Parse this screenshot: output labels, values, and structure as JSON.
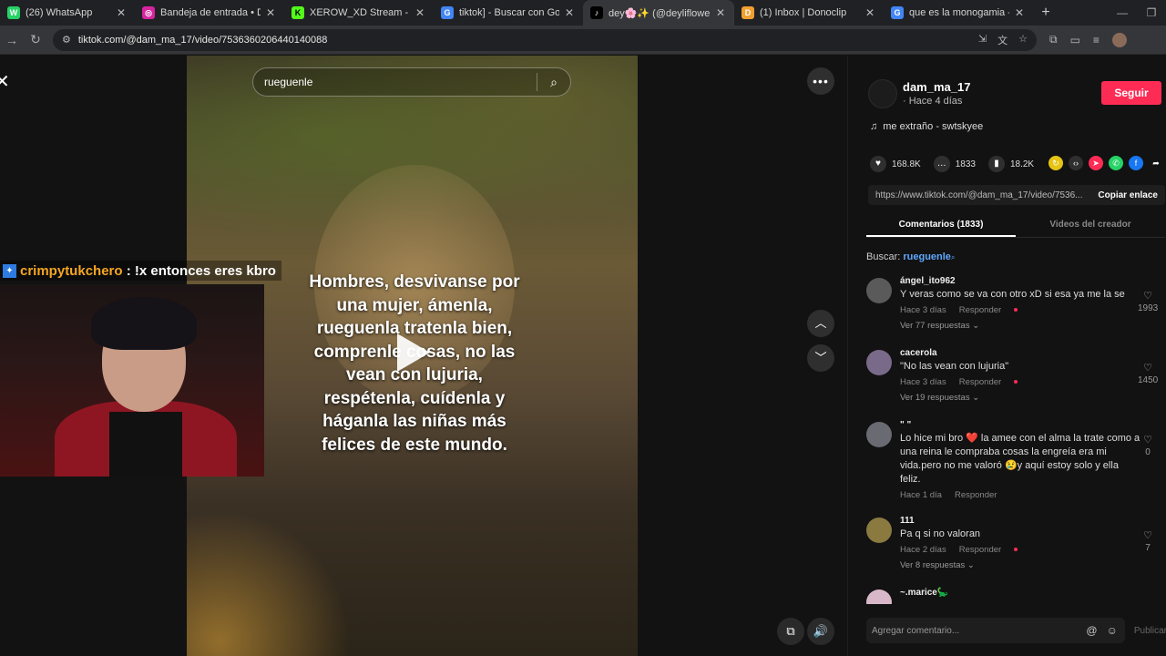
{
  "browser": {
    "tabs": [
      {
        "title": "(26) WhatsApp",
        "color": "#25d366",
        "glyph": "W"
      },
      {
        "title": "Bandeja de entrada • Direct",
        "color": "#d6249f",
        "glyph": "◎"
      },
      {
        "title": "XEROW_XD Stream - Watch Liv",
        "color": "#53fc18",
        "glyph": "K"
      },
      {
        "title": "tiktok] - Buscar con Google",
        "color": "#4285f4",
        "glyph": "G"
      },
      {
        "title": "dey🌸✨ (@deyliflower) | Ti",
        "color": "#000000",
        "glyph": "♪"
      },
      {
        "title": "(1) Inbox | Donoclip",
        "color": "#f0a030",
        "glyph": "D"
      },
      {
        "title": "que es la monogamia - Buscar",
        "color": "#4285f4",
        "glyph": "G"
      }
    ],
    "new_tab": "+",
    "url": "tiktok.com/@dam_ma_17/video/7536360206440140088"
  },
  "video": {
    "search_query": "rueguenle",
    "caption_lines": [
      "Hombres, desvivanse por",
      "una mujer, ámenla,",
      "rueguenla tratenla bien,",
      "comprenle cosas, no las",
      "vean con lujuria,",
      "respétenla, cuídenla y",
      "háganla las niñas más",
      "felices de este mundo."
    ]
  },
  "stream": {
    "chat_user": "crimpytukchero",
    "chat_message": " : !x entonces eres kbro"
  },
  "panel": {
    "creator": "dam_ma_17",
    "posted": "· Hace 4 días",
    "follow_label": "Seguir",
    "music": "me extraño - swtskyee",
    "likes": "168.8K",
    "comments_count": "1833",
    "saves": "18.2K",
    "link": "https://www.tiktok.com/@dam_ma_17/video/7536...",
    "copy_label": "Copiar enlace",
    "tab_comments": "Comentarios (1833)",
    "tab_creator": "Videos del creador",
    "search_label": "Buscar:",
    "search_term": "rueguenle",
    "composer_placeholder": "Agregar comentario...",
    "publish_label": "Publicar"
  },
  "comments": [
    {
      "user": "ángel_ito962",
      "text": "Y veras como se va con otro xD si esa ya me la se",
      "meta_time": "Hace 3 días",
      "reply": "Responder",
      "more": "Ver 77 respuestas ⌄",
      "likes": "1993",
      "avatar_color": "#5a5a5a"
    },
    {
      "user": "cacerola",
      "text": "\"No las vean con lujuria\"",
      "meta_time": "Hace 3 días",
      "reply": "Responder",
      "more": "Ver 19 respuestas ⌄",
      "likes": "1450",
      "avatar_color": "#7a6a8a"
    },
    {
      "user": "\" \"",
      "text": "Lo hice mi bro ❤️ la amee con el alma la trate como a una reina le compraba cosas la engreía era mi vida.pero no me valoró 😢y aquí estoy solo y ella feliz.",
      "meta_time": "Hace 1 día",
      "reply": "Responder",
      "more": "",
      "likes": "0",
      "avatar_color": "#6a6a72"
    },
    {
      "user": "111",
      "text": "Pa q si no valoran",
      "meta_time": "Hace 2 días",
      "reply": "Responder",
      "more": "Ver 8 respuestas ⌄",
      "likes": "7",
      "avatar_color": "#8a7a40"
    },
    {
      "user": "~.marice🦕",
      "text": "",
      "meta_time": "",
      "reply": "",
      "more": "",
      "likes": "",
      "avatar_color": "#d8b8c8"
    }
  ]
}
